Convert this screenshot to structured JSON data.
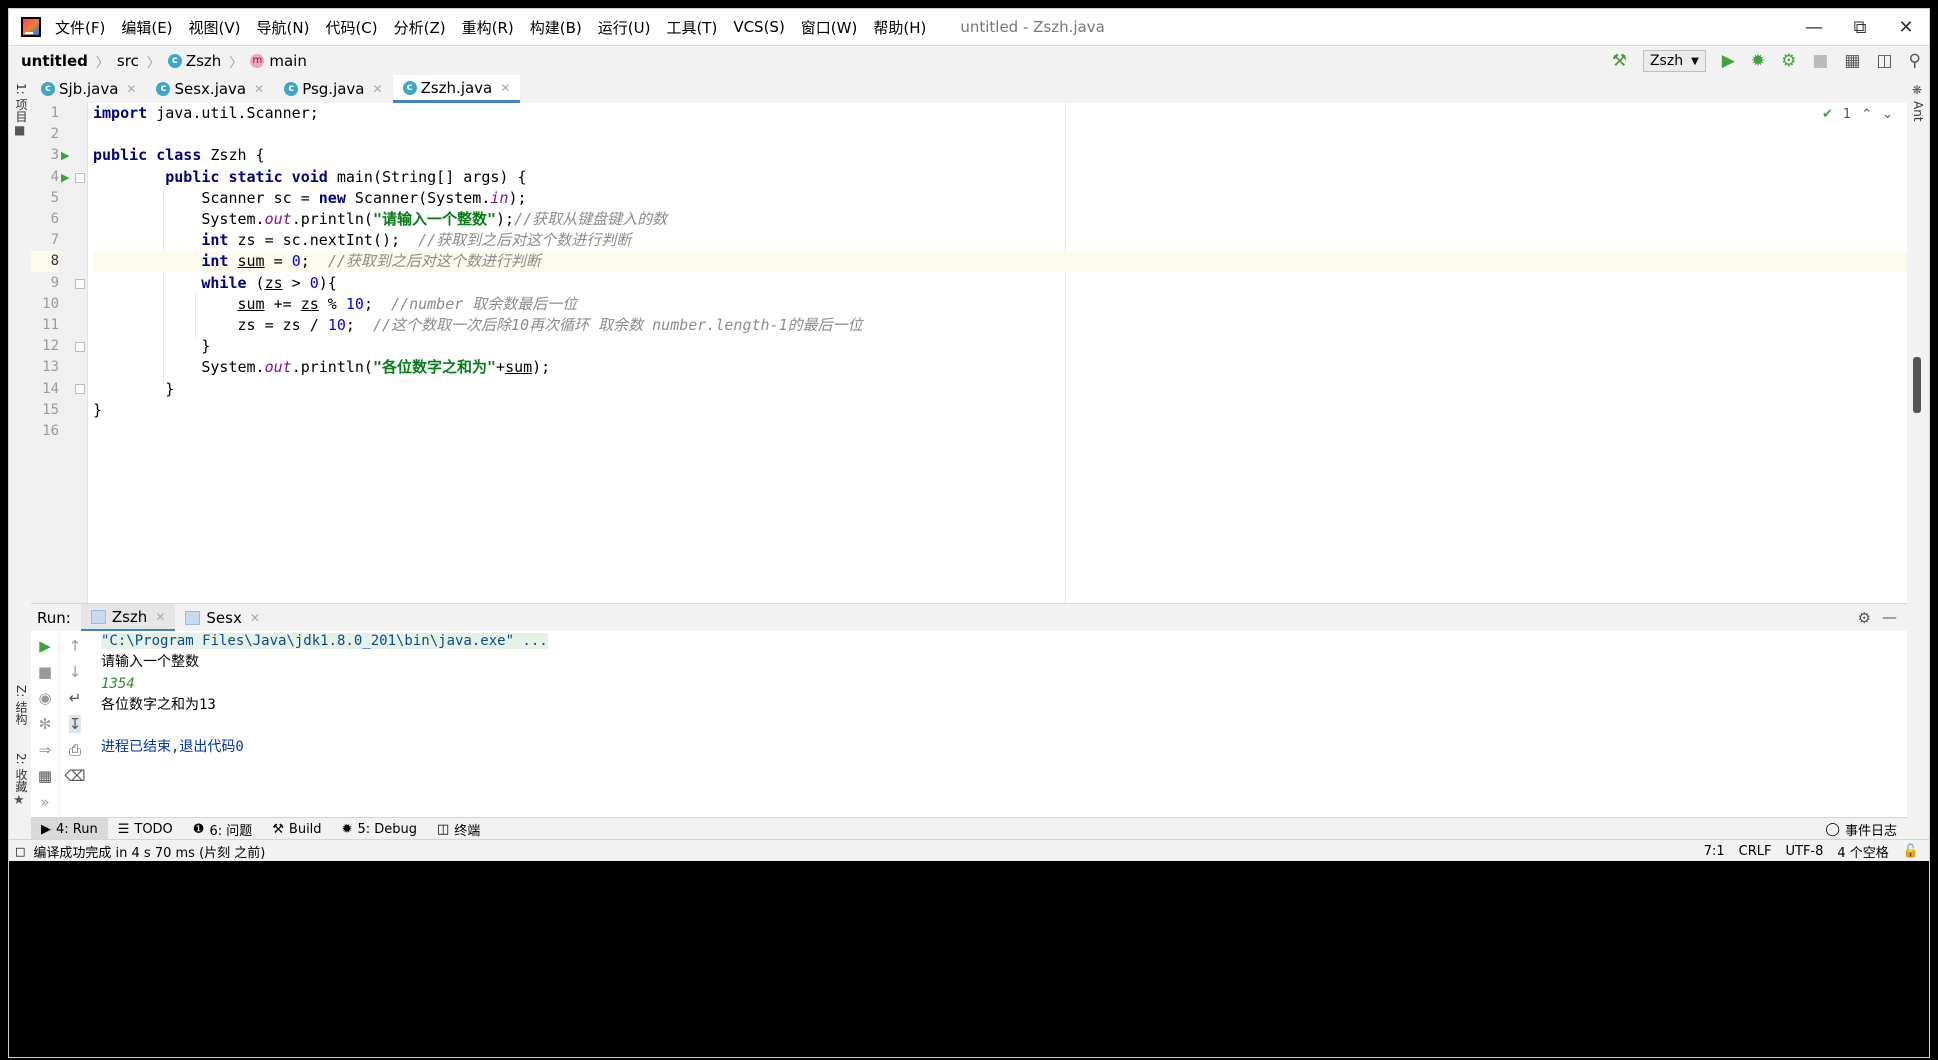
{
  "menubar": {
    "items": [
      "文件(F)",
      "编辑(E)",
      "视图(V)",
      "导航(N)",
      "代码(C)",
      "分析(Z)",
      "重构(R)",
      "构建(B)",
      "运行(U)",
      "工具(T)",
      "VCS(S)",
      "窗口(W)",
      "帮助(H)"
    ],
    "window_title": "untitled - Zszh.java"
  },
  "breadcrumb": {
    "project": "untitled",
    "folder": "src",
    "class": "Zszh",
    "method": "main"
  },
  "toolbar": {
    "run_config": "Zszh"
  },
  "left_strip": {
    "project_label": "1: 项目",
    "structure_label": "Z: 结构",
    "favorites_label": "2: 收藏"
  },
  "right_strip": {
    "ant_label": "Ant"
  },
  "tabs": [
    "Sjb.java",
    "Sesx.java",
    "Psg.java",
    "Zszh.java"
  ],
  "active_tab": "Zszh.java",
  "inspection": {
    "count": "1"
  },
  "editor": {
    "current_line": 8,
    "line_numbers": [
      "1",
      "2",
      "3",
      "4",
      "5",
      "6",
      "7",
      "8",
      "9",
      "10",
      "11",
      "12",
      "13",
      "14",
      "15",
      "16"
    ]
  },
  "run_panel": {
    "label": "Run:",
    "tabs": [
      "Zszh",
      "Sesx"
    ],
    "console": [
      "\"C:\\Program Files\\Java\\jdk1.8.0_201\\bin\\java.exe\" ...",
      "请输入一个整数",
      "1354",
      "各位数字之和为13",
      "",
      "进程已结束,退出代码0"
    ]
  },
  "bottom_tools": {
    "run": "4: Run",
    "todo": "TODO",
    "problems": "6: 问题",
    "build": "Build",
    "debug": "5: Debug",
    "terminal": "终端",
    "event_log": "事件日志"
  },
  "status": {
    "message": "编译成功完成 in 4 s 70 ms (片刻 之前)",
    "position": "7:1",
    "line_sep": "CRLF",
    "encoding": "UTF-8",
    "indent": "4 个空格"
  },
  "colors": {
    "keyword": "#000080",
    "string": "#067d17",
    "number": "#0000ff",
    "comment": "#8c8c8c",
    "accent": "#4083c9"
  }
}
